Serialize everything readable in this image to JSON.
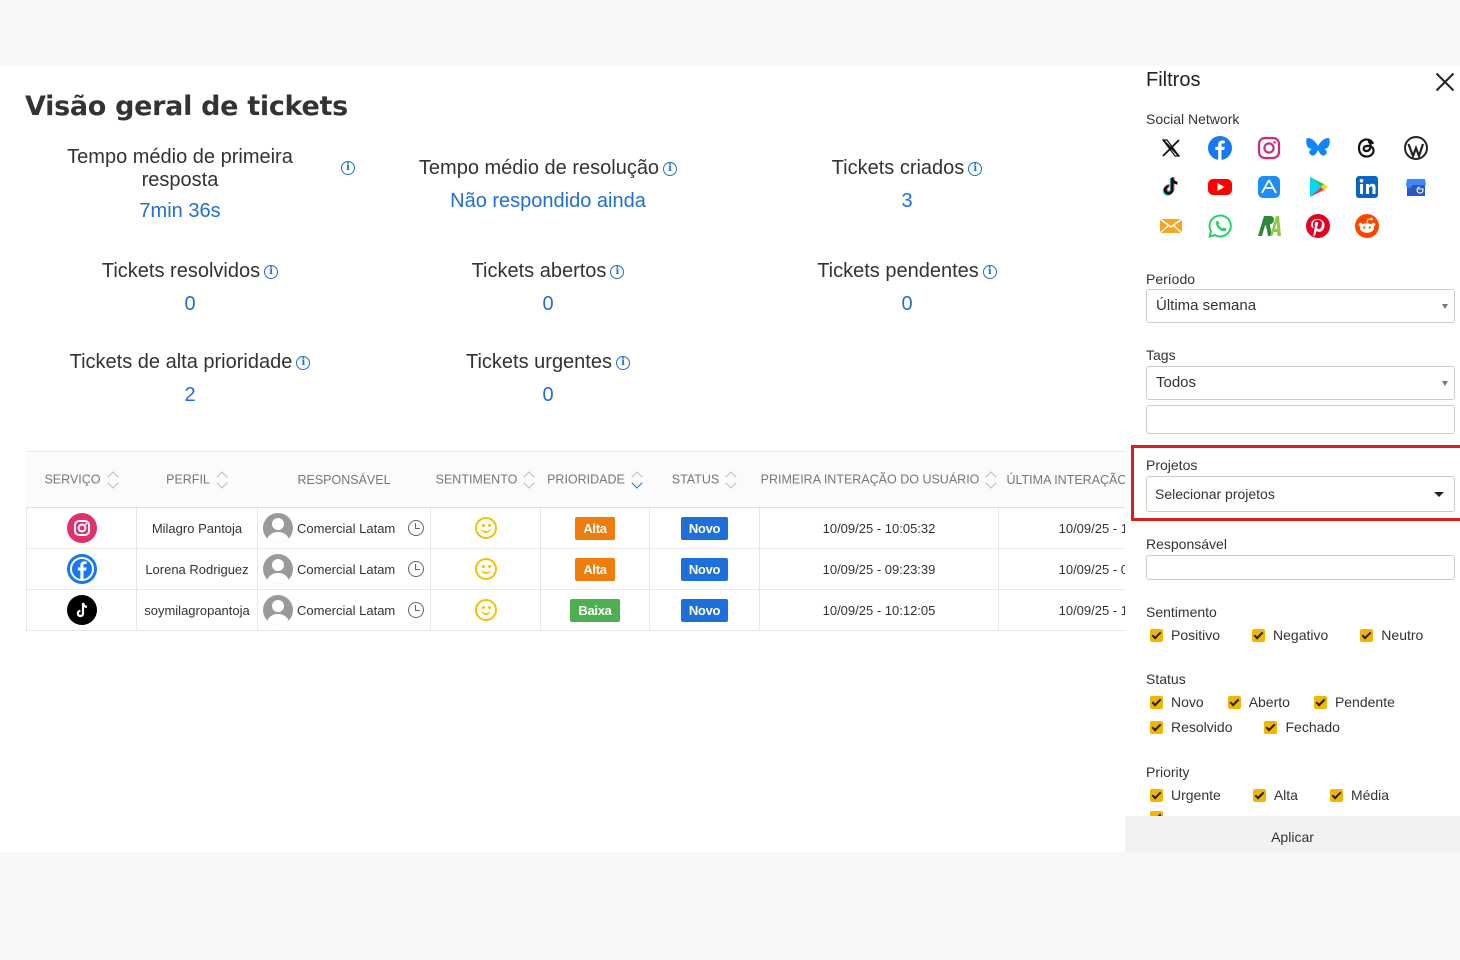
{
  "page": {
    "title": "Visão geral de tickets"
  },
  "metrics": [
    {
      "label": "Tempo médio de primeira resposta",
      "value": "7min 36s"
    },
    {
      "label": "Tempo médio de resolução",
      "value": "Não respondido ainda"
    },
    {
      "label": "Tickets criados",
      "value": "3"
    },
    {
      "label": "Tickets resolvidos",
      "value": "0"
    },
    {
      "label": "Tickets abertos",
      "value": "0"
    },
    {
      "label": "Tickets pendentes",
      "value": "0"
    },
    {
      "label": "Tickets de alta prioridade",
      "value": "2"
    },
    {
      "label": "Tickets urgentes",
      "value": "0"
    }
  ],
  "info_glyph": "i",
  "table": {
    "headers": [
      "Serviço",
      "Perfil",
      "Responsável",
      "Sentimento",
      "Prioridade",
      "Status",
      "Primeira interação do usuário",
      "Última interação do usuário"
    ],
    "rows": [
      {
        "service": "instagram",
        "profile": "Milagro Pantoja",
        "responsible": "Comercial Latam",
        "sentiment": "positive",
        "priority": "Alta",
        "status": "Novo",
        "first": "10/09/25 - 10:05:32",
        "last": "10/09/25 - 1"
      },
      {
        "service": "facebook",
        "profile": "Lorena Rodriguez",
        "responsible": "Comercial Latam",
        "sentiment": "positive",
        "priority": "Alta",
        "status": "Novo",
        "first": "10/09/25 - 09:23:39",
        "last": "10/09/25 - 0"
      },
      {
        "service": "tiktok",
        "profile": "soymilagropantoja",
        "responsible": "Comercial Latam",
        "sentiment": "positive",
        "priority": "Baixa",
        "status": "Novo",
        "first": "10/09/25 - 10:12:05",
        "last": "10/09/25 - 1"
      }
    ]
  },
  "colors": {
    "accent": "#1f6fd8",
    "alta": "#ee7d0b",
    "baixa": "#4caf50",
    "novo": "#1f6fd8",
    "checkbox": "#f2b600",
    "highlight": "#d81e1e"
  },
  "filters": {
    "title": "Filtros",
    "social_label": "Social Network",
    "networks": [
      "x",
      "facebook",
      "instagram",
      "bluesky",
      "threads",
      "wordpress",
      "tiktok",
      "youtube",
      "app-store",
      "google-play",
      "linkedin",
      "google-business",
      "email",
      "whatsapp",
      "reclame-aqui",
      "pinterest",
      "reddit"
    ],
    "period_label": "Período",
    "period_value": "Última semana",
    "tags_label": "Tags",
    "tags_value": "Todos",
    "projects_label": "Projetos",
    "projects_placeholder": "Selecionar projetos",
    "responsible_label": "Responsável",
    "sentiment_label": "Sentimento",
    "sentiment_options": [
      "Positivo",
      "Negativo",
      "Neutro"
    ],
    "status_label": "Status",
    "status_row1": [
      "Novo",
      "Aberto",
      "Pendente"
    ],
    "status_row2": [
      "Resolvido",
      "Fechado"
    ],
    "priority_label": "Priority",
    "priority_options": [
      "Urgente",
      "Alta",
      "Média"
    ],
    "apply_label": "Aplicar"
  }
}
